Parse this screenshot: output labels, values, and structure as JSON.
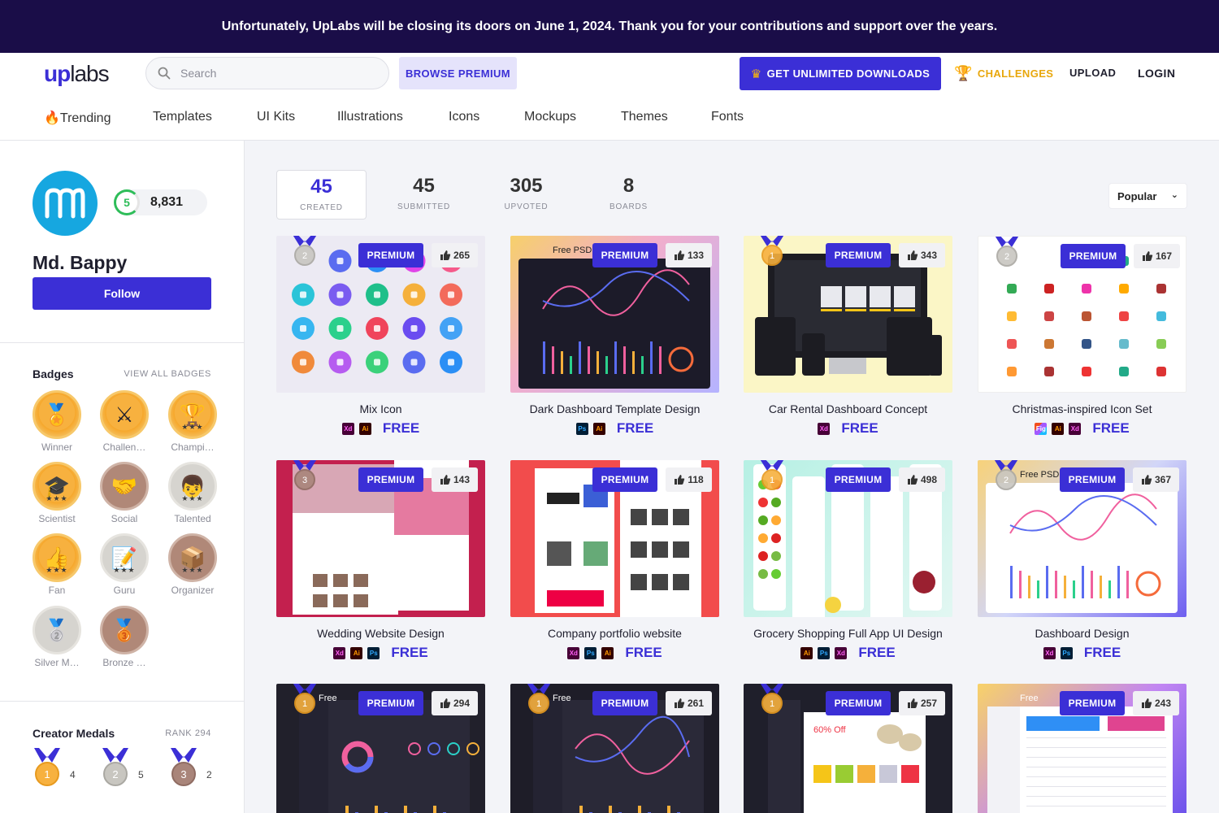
{
  "banner": {
    "text": "Unfortunately, UpLabs will be closing its doors on June 1, 2024. Thank you for your contributions and support over the years."
  },
  "header": {
    "logo_up": "up",
    "logo_labs": "labs",
    "search_placeholder": "Search",
    "browse_premium": "BROWSE PREMIUM",
    "unlimited": "GET UNLIMITED DOWNLOADS",
    "challenges": "CHALLENGES",
    "upload": "UPLOAD",
    "login": "LOGIN",
    "accent": "#3b2fd6"
  },
  "nav": [
    "Trending",
    "Templates",
    "UI Kits",
    "Illustrations",
    "Icons",
    "Mockups",
    "Themes",
    "Fonts"
  ],
  "profile": {
    "level": "5",
    "points": "8,831",
    "name": "Md. Bappy",
    "follow": "Follow",
    "avatar_color": "#16a7e0"
  },
  "badges": {
    "title": "Badges",
    "view_all": "VIEW ALL BADGES",
    "items": [
      {
        "label": "Winner",
        "icon": "medal-icon",
        "tier": "gold",
        "stars": ""
      },
      {
        "label": "Challen…",
        "icon": "swords-icon",
        "tier": "gold",
        "stars": ""
      },
      {
        "label": "Champi…",
        "icon": "trophy-icon",
        "tier": "gold",
        "stars": "★★★"
      },
      {
        "label": "Scientist",
        "icon": "graduation-cap-icon",
        "tier": "gold",
        "stars": "★★★"
      },
      {
        "label": "Social",
        "icon": "handshake-icon",
        "tier": "bronze",
        "stars": ""
      },
      {
        "label": "Talented",
        "icon": "face-icon",
        "tier": "silver",
        "stars": "★★★"
      },
      {
        "label": "Fan",
        "icon": "thumbs-up-icon",
        "tier": "gold",
        "stars": "★★★"
      },
      {
        "label": "Guru",
        "icon": "notepad-icon",
        "tier": "silver",
        "stars": "★★★"
      },
      {
        "label": "Organizer",
        "icon": "box-icon",
        "tier": "bronze",
        "stars": "★★★"
      },
      {
        "label": "Silver M…",
        "icon": "silver-medal-icon",
        "tier": "silver",
        "stars": ""
      },
      {
        "label": "Bronze …",
        "icon": "bronze-medal-icon",
        "tier": "bronze",
        "stars": ""
      }
    ]
  },
  "creator_medals": {
    "title": "Creator Medals",
    "rank": "RANK 294",
    "items": [
      {
        "place": "1",
        "count": "4"
      },
      {
        "place": "2",
        "count": "5"
      },
      {
        "place": "3",
        "count": "2"
      }
    ]
  },
  "stats": [
    {
      "value": "45",
      "label": "CREATED"
    },
    {
      "value": "45",
      "label": "SUBMITTED"
    },
    {
      "value": "305",
      "label": "UPVOTED"
    },
    {
      "value": "8",
      "label": "BOARDS"
    }
  ],
  "sort": "Popular",
  "premium_label": "PREMIUM",
  "free_label": "FREE",
  "cards": [
    {
      "title": "Mix Icon",
      "likes": "265",
      "medal": "2",
      "tools": [
        "Xd",
        "Ai"
      ],
      "overlay": ""
    },
    {
      "title": "Dark Dashboard Template Design",
      "likes": "133",
      "medal": "",
      "tools": [
        "Ps",
        "Ai"
      ],
      "overlay": "Free PSD D"
    },
    {
      "title": "Car Rental Dashboard Concept",
      "likes": "343",
      "medal": "1",
      "tools": [
        "Xd"
      ],
      "overlay": ""
    },
    {
      "title": "Christmas-inspired Icon Set",
      "likes": "167",
      "medal": "2",
      "tools": [
        "Fig",
        "Ai",
        "Xd"
      ],
      "overlay": ""
    },
    {
      "title": "Wedding Website Design",
      "likes": "143",
      "medal": "3",
      "tools": [
        "Xd",
        "Ai",
        "Ps"
      ],
      "overlay": ""
    },
    {
      "title": "Company portfolio website",
      "likes": "118",
      "medal": "",
      "tools": [
        "Xd",
        "Ps",
        "Ai"
      ],
      "overlay": ""
    },
    {
      "title": "Grocery Shopping Full App UI Design",
      "likes": "498",
      "medal": "1",
      "tools": [
        "Ai",
        "Ps",
        "Xd"
      ],
      "overlay": ""
    },
    {
      "title": "Dashboard Design",
      "likes": "367",
      "medal": "2",
      "tools": [
        "Xd",
        "Ps"
      ],
      "overlay": "Free PSD D"
    },
    {
      "title": "",
      "likes": "294",
      "medal": "1",
      "tools": [],
      "overlay": "Free"
    },
    {
      "title": "",
      "likes": "261",
      "medal": "1",
      "tools": [],
      "overlay": "Free"
    },
    {
      "title": "",
      "likes": "257",
      "medal": "1",
      "tools": [],
      "overlay": ""
    },
    {
      "title": "",
      "likes": "243",
      "medal": "",
      "tools": [],
      "overlay": "Free"
    }
  ]
}
